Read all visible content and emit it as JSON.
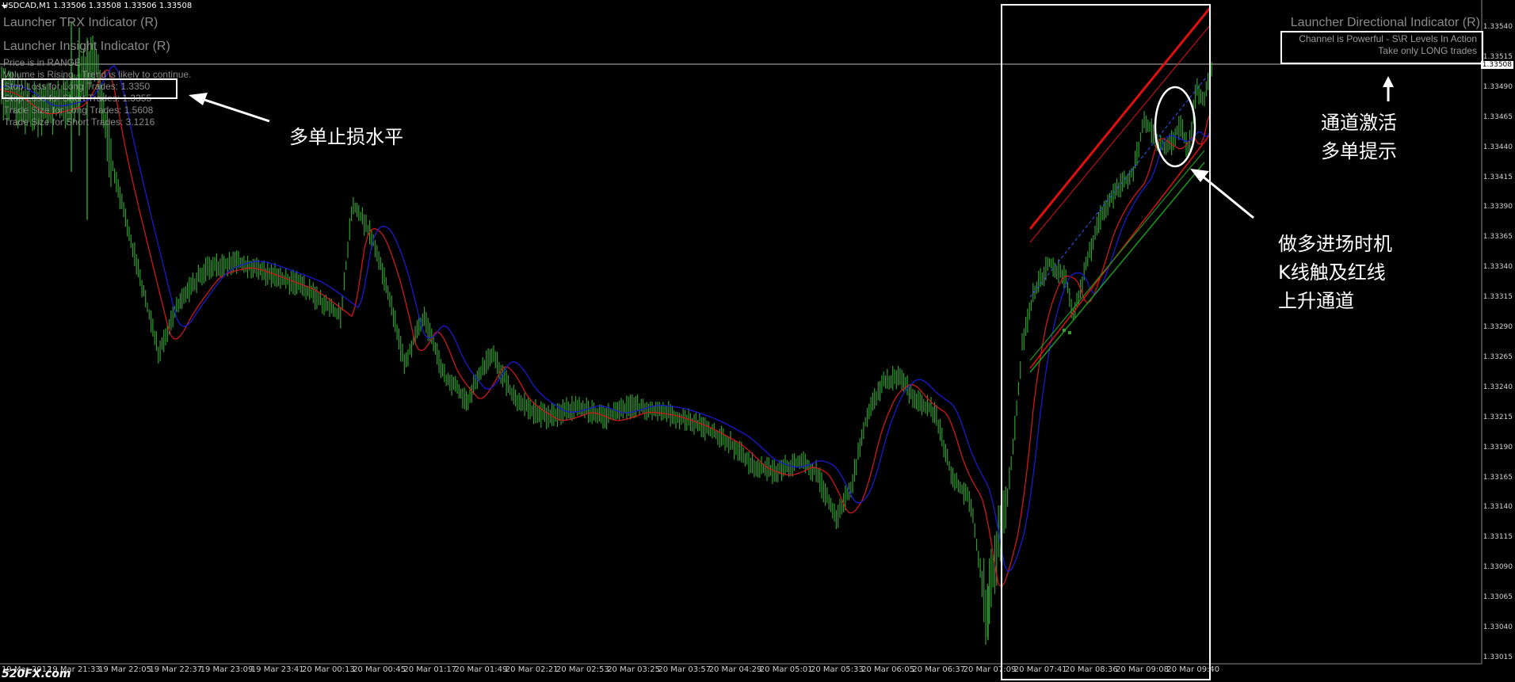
{
  "symbol_header": "USDCAD,M1  1.33506 1.33508 1.33506 1.33508",
  "indicators": {
    "trx": "Launcher TRX Indicator (R)",
    "insight": "Launcher Insight Indicator (R)",
    "price_range": "Price is in RANGE",
    "volume": "Volume is Rising - Trend is likely to continue.",
    "stop_long": "Stop Loss for Long Trades: 1.3350",
    "stop_short": "Stop Loss for Short Trades: 1.3355",
    "size_long": "Trade Size for Long Trades: 1.5608",
    "size_short": "Trade Size for Short Trades: 3.1216",
    "directional": "Launcher Directional Indicator (R)",
    "channel": "Channel is Powerful - S\\R Levels In Action",
    "take_long": "Take only LONG trades"
  },
  "annotations": {
    "stop_level": "多单止损水平",
    "channel_1": "通道激活",
    "channel_2": "多单提示",
    "entry_1": "做多进场时机",
    "entry_2": "K线触及红线",
    "entry_3": "上升通道"
  },
  "price_scale": {
    "current_price": "1.33508",
    "ticks": [
      "1.33540",
      "1.33515",
      "1.33490",
      "1.33465",
      "1.33440",
      "1.33415",
      "1.33390",
      "1.33365",
      "1.33340",
      "1.33315",
      "1.33290",
      "1.33265",
      "1.33240",
      "1.33215",
      "1.33190",
      "1.33165",
      "1.33140",
      "1.33115",
      "1.33090",
      "1.33065",
      "1.33040",
      "1.33015"
    ]
  },
  "time_axis": {
    "labels": [
      "19 Mar 2012",
      "19 Mar 21:33",
      "19 Mar 22:05",
      "19 Mar 22:37",
      "19 Mar 23:09",
      "19 Mar 23:41",
      "20 Mar 00:13",
      "20 Mar 00:45",
      "20 Mar 01:17",
      "20 Mar 01:49",
      "20 Mar 02:21",
      "20 Mar 02:53",
      "20 Mar 03:25",
      "20 Mar 03:57",
      "20 Mar 04:29",
      "20 Mar 05:01",
      "20 Mar 05:33",
      "20 Mar 06:05",
      "20 Mar 06:37",
      "20 Mar 07:09",
      "20 Mar 07:41",
      "20 Mar 08:36",
      "20 Mar 09:08",
      "20 Mar 09:40"
    ]
  },
  "watermark": "520FX.com",
  "colors": {
    "background": "#000000",
    "candles": "#2e9e2e",
    "ma_fast": "#d01818",
    "ma_slow": "#1a1ad0",
    "channel_upper": "#e01010",
    "channel_lower": "#1a9a1a",
    "annotation": "#ffffff",
    "indicator_text": "#8a8a8a"
  }
}
